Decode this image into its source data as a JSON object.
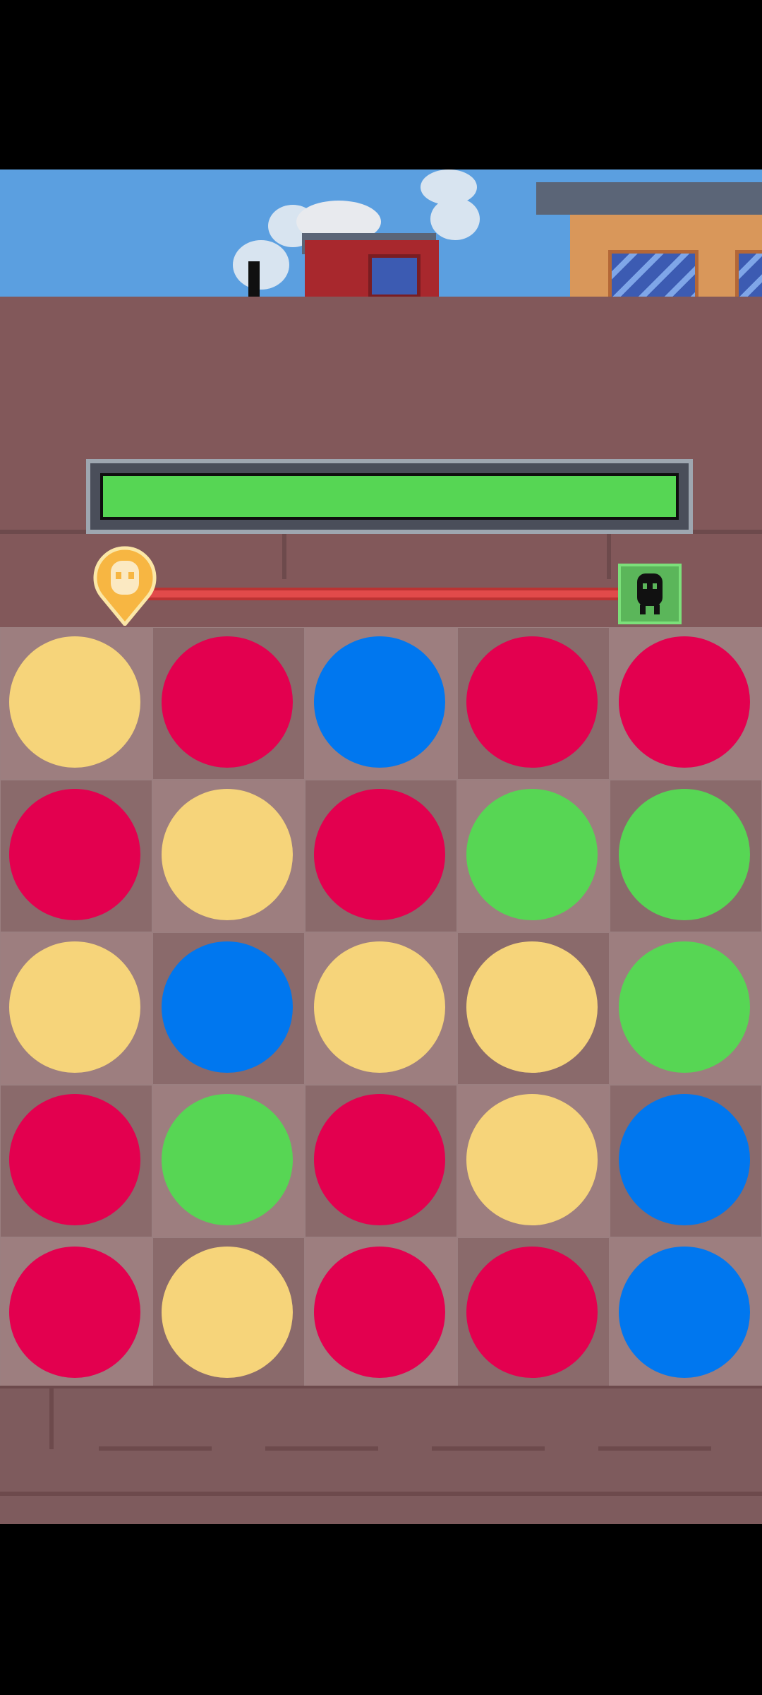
{
  "colors": {
    "yellow": "#f6d47a",
    "red": "#e3004f",
    "blue": "#0077ef",
    "green": "#57d654"
  },
  "progress": {
    "fraction": 1.0
  },
  "player_icon": "ghost-pin-icon",
  "enemy_icon": "enemy-creature-icon",
  "board": {
    "rows": [
      [
        "yellow",
        "red",
        "blue",
        "red",
        "red"
      ],
      [
        "red",
        "yellow",
        "red",
        "green",
        "green"
      ],
      [
        "yellow",
        "blue",
        "yellow",
        "yellow",
        "green"
      ],
      [
        "red",
        "green",
        "red",
        "yellow",
        "blue"
      ],
      [
        "red",
        "yellow",
        "red",
        "red",
        "blue"
      ]
    ]
  }
}
